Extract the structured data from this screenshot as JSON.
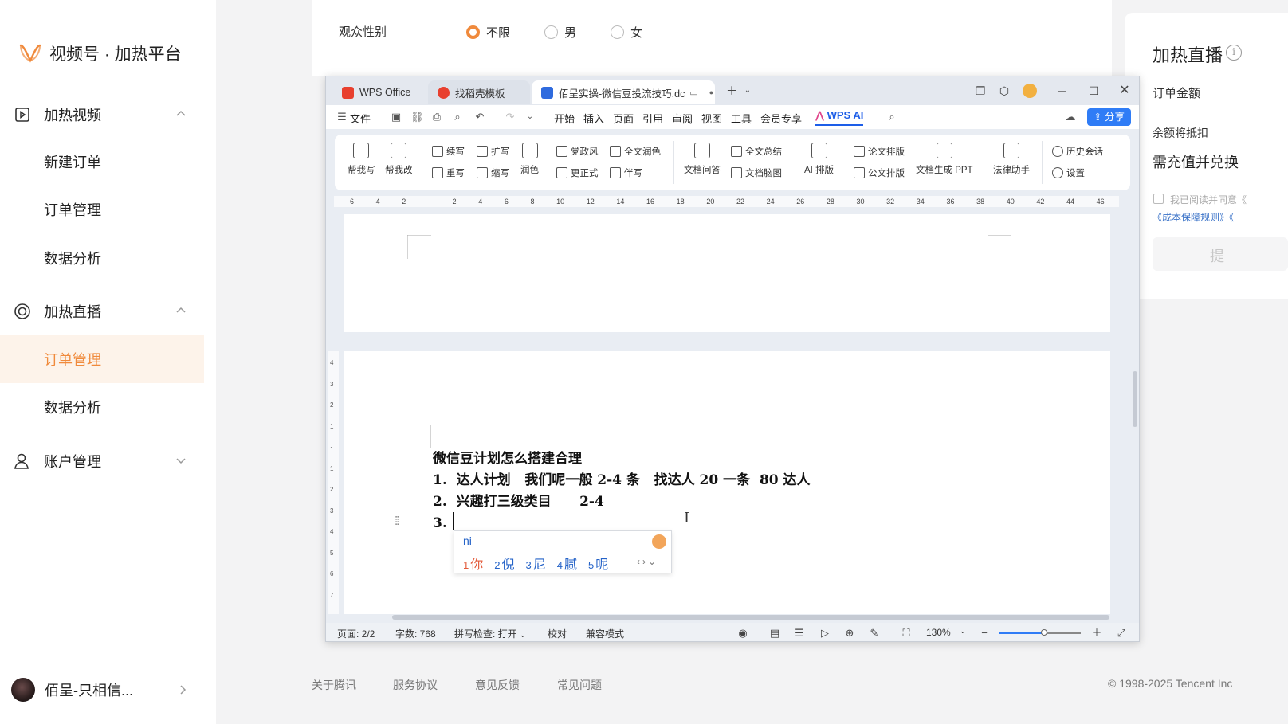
{
  "brand": {
    "title": "视频号 · 加热平台",
    "accent": "#f08a3c"
  },
  "sidebar": {
    "groups": [
      {
        "label": "加热视频",
        "items": [
          "新建订单",
          "订单管理",
          "数据分析"
        ]
      },
      {
        "label": "加热直播",
        "items": [
          "订单管理",
          "数据分析"
        ],
        "active_item": "订单管理"
      },
      {
        "label": "账户管理",
        "items": []
      }
    ],
    "user": {
      "name": "佰呈-只相信..."
    }
  },
  "form": {
    "gender_label": "观众性别",
    "gender_options": [
      "不限",
      "男",
      "女"
    ],
    "gender_selected": "不限"
  },
  "right_panel": {
    "title": "加热直播",
    "order_amount_label": "订单金额",
    "deduct_label": "余额将抵扣",
    "recharge_text": "需充值并兑换",
    "agree_text": "我已阅读并同意《",
    "rules_text": "《成本保障规则》《",
    "submit_label": "提"
  },
  "footer": {
    "links": [
      "关于腾讯",
      "服务协议",
      "意见反馈",
      "常见问题"
    ],
    "copyright": "© 1998-2025 Tencent Inc"
  },
  "wps": {
    "tabs": [
      "WPS Office",
      "找稻壳模板",
      "佰呈实操-微信豆投流技巧.dc"
    ],
    "menu": [
      "文件",
      "开始",
      "插入",
      "页面",
      "引用",
      "审阅",
      "视图",
      "工具",
      "会员专享"
    ],
    "wps_ai": "WPS AI",
    "share": "分享",
    "ribbon": {
      "help_write": "帮我写",
      "help_edit": "帮我改",
      "continue": "续写",
      "rewrite": "重写",
      "expand": "扩写",
      "shorten": "缩写",
      "polish": "润色",
      "party_style": "党政风",
      "formal": "更正式",
      "full_polish": "全文润色",
      "companion": "伴写",
      "doc_qa": "文档问答",
      "summary": "全文总结",
      "mindmap": "文档脑图",
      "ai_layout": "AI 排版",
      "paper_layout": "论文排版",
      "official_layout": "公文排版",
      "gen_ppt": "文档生成 PPT",
      "legal": "法律助手",
      "history": "历史会话",
      "settings": "设置"
    },
    "ruler_ticks": [
      "6",
      "4",
      "2",
      "",
      "2",
      "4",
      "6",
      "8",
      "10",
      "12",
      "14",
      "16",
      "18",
      "20",
      "22",
      "24",
      "26",
      "28",
      "30",
      "32",
      "34",
      "36",
      "38",
      "40",
      "42",
      "44",
      "46"
    ],
    "vruler_ticks": [
      "4",
      "3",
      "2",
      "1",
      "",
      "1",
      "2",
      "3",
      "4",
      "5",
      "6",
      "7"
    ],
    "document": {
      "title": "微信豆计划怎么搭建合理",
      "line1": "1.  达人计划   我们呢一般 2-4 条   找达人 20 一条  80 达人",
      "line2": "2.  兴趣打三级类目      2-4",
      "line3": "3. "
    },
    "ime": {
      "composition": "ni",
      "candidates": [
        {
          "n": "1",
          "w": "你"
        },
        {
          "n": "2",
          "w": "倪"
        },
        {
          "n": "3",
          "w": "尼"
        },
        {
          "n": "4",
          "w": "腻"
        },
        {
          "n": "5",
          "w": "呢"
        }
      ]
    },
    "status": {
      "page": "页面: 2/2",
      "words": "字数: 768",
      "spell": "拼写检查: 打开",
      "proof": "校对",
      "compat": "兼容模式",
      "zoom": "130%",
      "zoom_level": 0.55
    }
  }
}
